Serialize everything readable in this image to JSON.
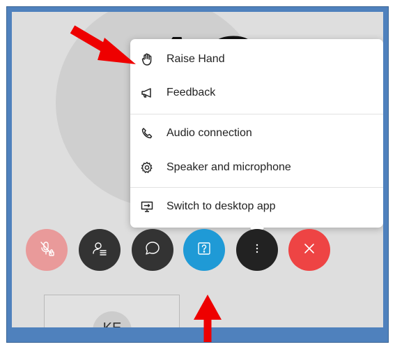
{
  "meeting": {
    "presenter_initials": "AS",
    "thumbnail_initials": "KE"
  },
  "menu": {
    "items": [
      {
        "label": "Raise Hand",
        "icon": "hand-icon"
      },
      {
        "label": "Feedback",
        "icon": "megaphone-icon"
      },
      {
        "label": "Audio connection",
        "icon": "phone-icon"
      },
      {
        "label": "Speaker and microphone",
        "icon": "gear-icon"
      },
      {
        "label": "Switch to desktop app",
        "icon": "desktop-icon"
      }
    ]
  },
  "controls": [
    {
      "name": "mute",
      "icon": "muted-mic-lock-icon",
      "color": "#e99a9a"
    },
    {
      "name": "participants",
      "icon": "participants-icon",
      "color": "#333333"
    },
    {
      "name": "chat",
      "icon": "chat-icon",
      "color": "#333333"
    },
    {
      "name": "q-and-a",
      "icon": "question-icon",
      "color": "#1f9ad6"
    },
    {
      "name": "more",
      "icon": "more-dots-icon",
      "color": "#222222"
    },
    {
      "name": "leave",
      "icon": "close-icon",
      "color": "#ee4444"
    }
  ],
  "colors": {
    "annotation_arrow": "#ee0000",
    "frame": "#4f81bd"
  }
}
